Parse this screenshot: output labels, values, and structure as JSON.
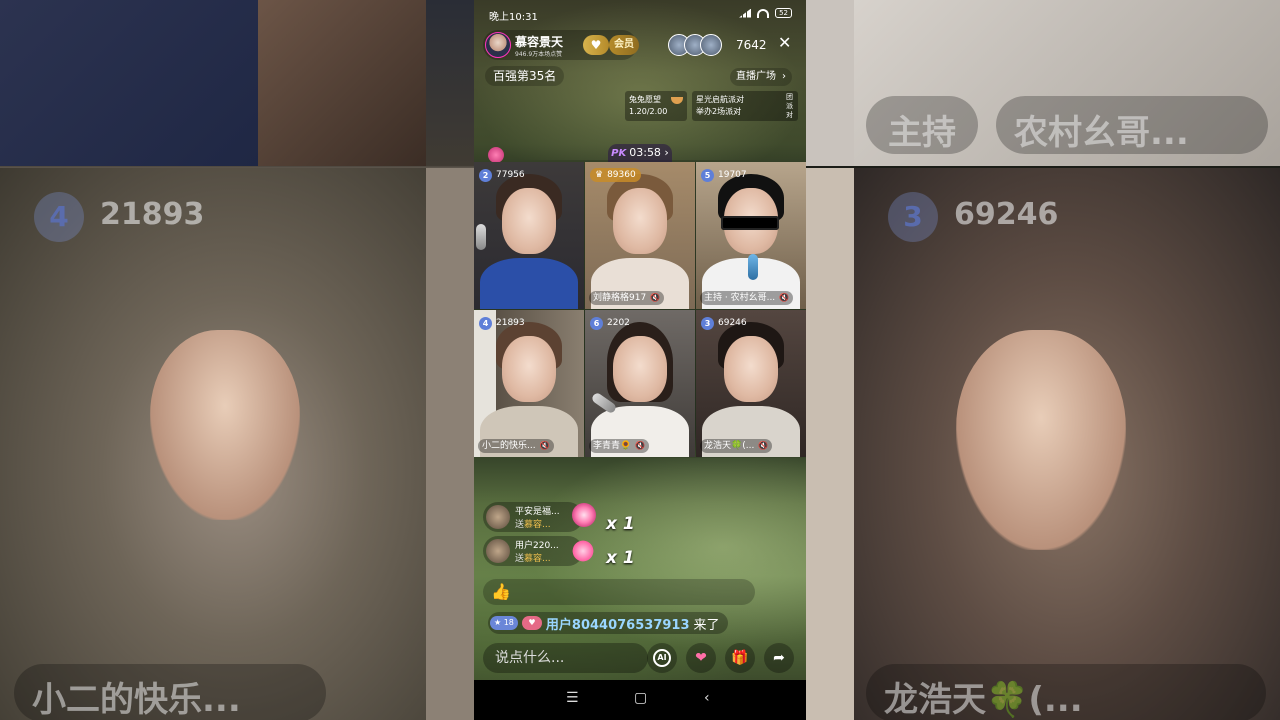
{
  "background": {
    "left_label": "小二的快乐...",
    "left_badge": "4",
    "left_score": "21893",
    "right_top_label_a": "主持",
    "right_top_label_b": "农村幺哥...",
    "right_badge": "3",
    "right_score": "69246",
    "right_label": "龙浩天🍀(..."
  },
  "status_bar": {
    "time": "晚上10:31",
    "battery": "52"
  },
  "host": {
    "name": "慕容景天",
    "subtitle": "946.9万本场点赞",
    "vip_label": "会员"
  },
  "viewer_count": "7642",
  "close_icon": "✕",
  "rank": "百强第35名",
  "plaza_label": "直播广场",
  "tasks": [
    {
      "title": "兔兔愿望",
      "progress": "1.20/2.00"
    },
    {
      "title": "星光启航派对",
      "detail": "举办2场派对",
      "side": "团派对"
    }
  ],
  "pk": {
    "badge": "PK",
    "timer": "03:58"
  },
  "tiles": [
    {
      "rank": "2",
      "score": "77956",
      "name": ""
    },
    {
      "rank": "",
      "score": "89360",
      "name": "刘静格格917"
    },
    {
      "rank": "5",
      "score": "19707",
      "name": "主持 · 农村幺哥..."
    },
    {
      "rank": "4",
      "score": "21893",
      "name": "小二的快乐..."
    },
    {
      "rank": "6",
      "score": "2202",
      "name": "李青青🌻"
    },
    {
      "rank": "3",
      "score": "69246",
      "name": "龙浩天🍀(..."
    }
  ],
  "gifts": [
    {
      "sender": "平安是福...",
      "to_prefix": "送",
      "to_name": "慕容...",
      "count": "x 1",
      "icon": "lollipop-icon"
    },
    {
      "sender": "用户220...",
      "to_prefix": "送",
      "to_name": "慕容...",
      "count": "x 1",
      "icon": "heart-gift-icon"
    }
  ],
  "like_emoji": "👍",
  "welcome": {
    "level": "18",
    "user": "用户8044076537913",
    "suffix": "来了"
  },
  "input_placeholder": "说点什么...",
  "buttons": {
    "ai": "AI",
    "heart": "❤",
    "gift": "🎁",
    "share": "➦"
  },
  "navbar": {
    "menu": "☰",
    "home": "▢",
    "back": "‹"
  },
  "colors": {
    "accent_gold": "#f2c14e",
    "username_blue": "#9ad6ff",
    "rank_badge": "#5f7fd8"
  }
}
